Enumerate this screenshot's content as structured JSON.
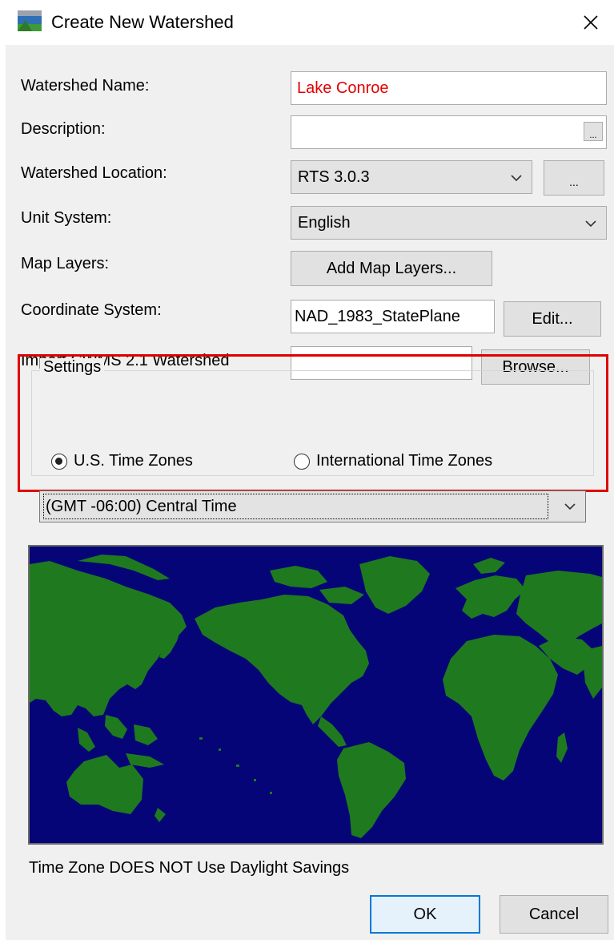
{
  "window": {
    "title": "Create New Watershed",
    "close_icon": "close-icon",
    "app_icon": "watershed-app-icon"
  },
  "form": {
    "watershed_name_label": "Watershed Name:",
    "watershed_name_value": "Lake Conroe",
    "description_label": "Description:",
    "description_value": "",
    "description_button": "...",
    "location_label": "Watershed Location:",
    "location_value": "RTS 3.0.3",
    "location_button": "...",
    "unit_system_label": "Unit System:",
    "unit_system_value": "English",
    "map_layers_label": "Map Layers:",
    "add_map_layers_button": "Add Map Layers...",
    "coordinate_system_label": "Coordinate System:",
    "coordinate_system_value": "NAD_1983_StatePlane",
    "edit_button": "Edit...",
    "import_label": "Import CWMS 2.1 Watershed",
    "import_value": "",
    "browse_button": "Browse..."
  },
  "settings": {
    "title": "Settings",
    "radio_us": "U.S. Time Zones",
    "radio_international": "International Time Zones",
    "selected_radio": "us",
    "time_zone_value": "(GMT -06:00) Central Time"
  },
  "map": {
    "ocean_color": "#050577",
    "land_color": "#1f7a1f"
  },
  "status": {
    "text": "Time Zone DOES NOT Use Daylight Savings"
  },
  "footer": {
    "ok_button": "OK",
    "cancel_button": "Cancel"
  },
  "colors": {
    "highlight_border": "#e00000",
    "name_text": "#e00000",
    "ok_border": "#0078d7"
  }
}
